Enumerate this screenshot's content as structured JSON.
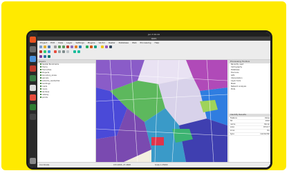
{
  "window": {
    "title": "QGIS",
    "clock": "Jan 3 09:44"
  },
  "menu": [
    "Project",
    "Edit",
    "View",
    "Layer",
    "Settings",
    "Plugins",
    "Vector",
    "Raster",
    "Database",
    "Web",
    "Processing",
    "Help"
  ],
  "layers_panel": {
    "title": "Layers",
    "items": [
      "Spatial Bookmarks",
      "Home",
      "Favourites",
      "Projects",
      "boundary_areas",
      "parcels",
      "suburbs_residential",
      "buildings",
      "roads",
      "rivers",
      "landuse",
      "railway",
      "points"
    ]
  },
  "right_panel": {
    "title": "Processing Toolbox",
    "items": [
      "Recently used",
      "Cartography",
      "Database",
      "File tools",
      "GPS",
      "Interpolation",
      "Layer tools",
      "Mesh",
      "Network analysis",
      "Plots"
    ],
    "attributes_title": "Identify Results",
    "rows": [
      [
        "Feature",
        "Value"
      ],
      [
        "fid",
        "1024"
      ],
      [
        "name",
        "Parcel"
      ],
      [
        "area",
        "4512.3"
      ],
      [
        "zone",
        "R2"
      ],
      [
        "type",
        "residential"
      ]
    ]
  },
  "status": {
    "label": "Coordinate",
    "coordinate": "153.0265,-27.4698",
    "scale": "Scale 1:25000"
  },
  "colors": {
    "frame": "#ffea00",
    "map_bg": "#f5efe0"
  }
}
